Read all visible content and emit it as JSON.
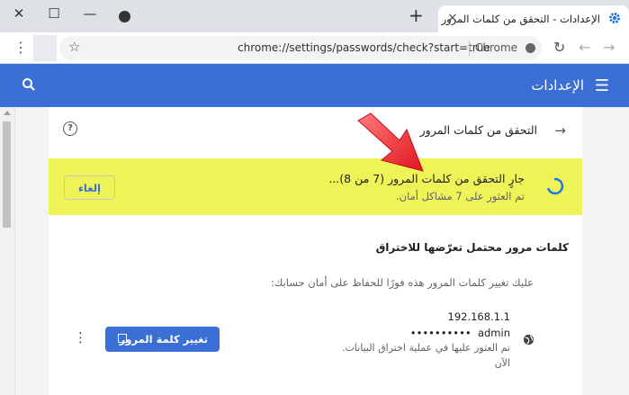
{
  "browser": {
    "tab_title": "الإعدادات - التحقق من كلمات المرور",
    "close_tab": "×",
    "new_tab": "+",
    "window_controls": {
      "close": "✕",
      "maximize": "☐",
      "minimize": "—"
    },
    "url": "chrome://settings/passwords/check?start=true",
    "site_label": "Chrome",
    "menu": "⋮",
    "star": "☆",
    "reload": "↻",
    "back": "←",
    "forward": "→"
  },
  "header": {
    "title": "الإعدادات",
    "menu_icon": "☰",
    "color": "#3b6fd6"
  },
  "page": {
    "title": "التحقق من كلمات المرور",
    "back": "→",
    "help": "?",
    "status": {
      "main": "جارٍ التحقق من كلمات المرور (7 من 8)...",
      "sub": "تم العثور على 7 مشاكل أمان.",
      "highlight_color": "#eef358"
    },
    "cancel_label": "إلغاء",
    "section_title": "كلمات مرور محتمل تعرّضها للاختراق",
    "section_subtitle": "عليك تغيير كلمات المرور هذه فورًا للحفاظ على أمان حسابك:",
    "compromised": [
      {
        "site": "192.168.1.1",
        "username": "admin",
        "masked_password": "••••••••••",
        "note": "تم العثور عليها في عملية اختراق البيانات.",
        "time": "الآن",
        "change_label": "تغيير كلمة المرور",
        "more": "⋮"
      }
    ]
  },
  "icons": {
    "settings": "gear-icon",
    "search": "search-icon",
    "spinner": "loading-spinner-icon",
    "globe": "globe-icon",
    "external_link": "external-link-icon",
    "annotation": "red-arrow-pointer"
  }
}
